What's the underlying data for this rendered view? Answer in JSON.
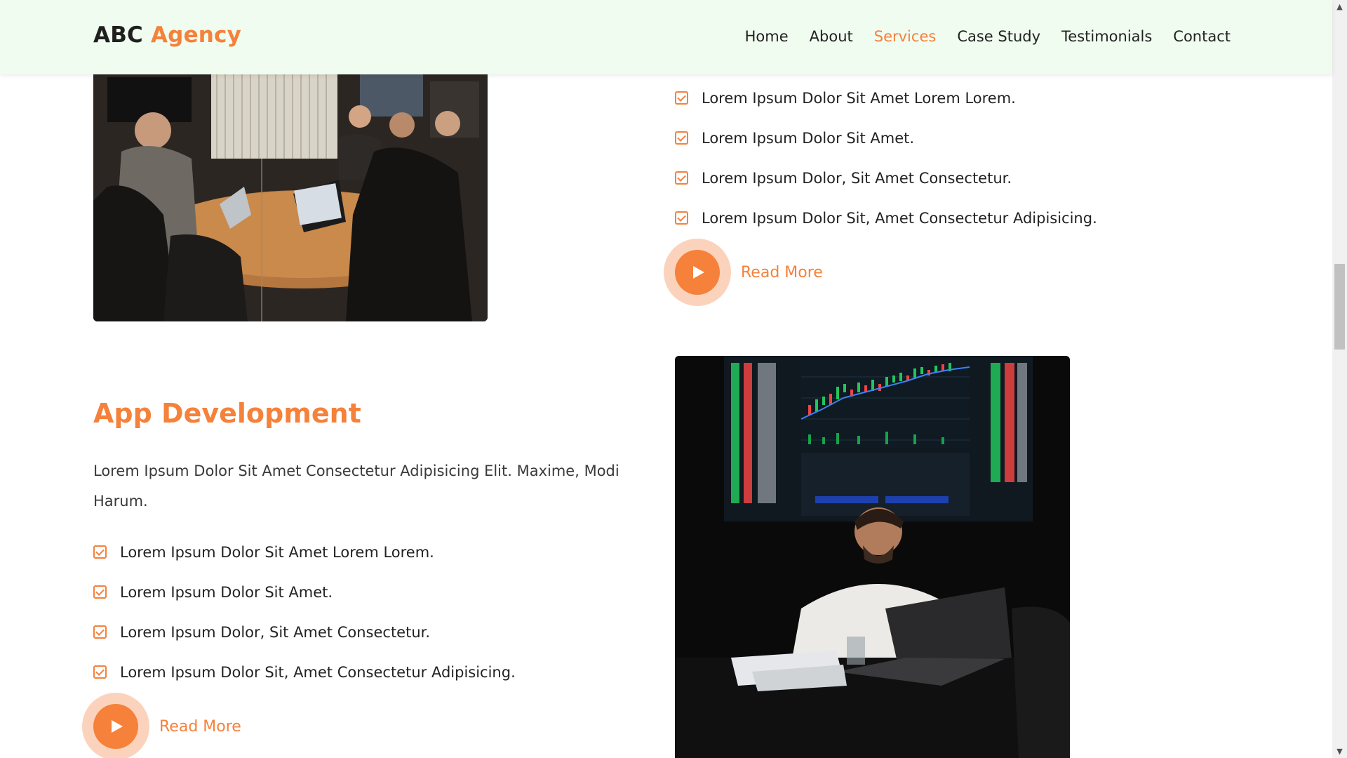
{
  "header": {
    "logo_primary": "ABC",
    "logo_accent": "Agency",
    "nav": [
      "Home",
      "About",
      "Services",
      "Case Study",
      "Testimonials",
      "Contact"
    ],
    "active_nav": "Services",
    "accent_color": "#f5813a",
    "background_color": "#effcef"
  },
  "section_top": {
    "image_description": "team meeting around a conference table",
    "checklist": [
      "Lorem Ipsum Dolor Sit Amet Lorem Lorem.",
      "Lorem Ipsum Dolor Sit Amet.",
      "Lorem Ipsum Dolor, Sit Amet Consectetur.",
      "Lorem Ipsum Dolor Sit, Amet Consectetur Adipisicing."
    ],
    "read_more": "Read More"
  },
  "section_app": {
    "title": "App Development",
    "description": "Lorem Ipsum Dolor Sit Amet Consectetur Adipisicing Elit. Maxime, Modi Harum.",
    "checklist": [
      "Lorem Ipsum Dolor Sit Amet Lorem Lorem.",
      "Lorem Ipsum Dolor Sit Amet.",
      "Lorem Ipsum Dolor, Sit Amet Consectetur.",
      "Lorem Ipsum Dolor Sit, Amet Consectetur Adipisicing."
    ],
    "read_more": "Read More"
  },
  "icons": {
    "checkbox": "checkbox-checked-icon",
    "play": "play-icon",
    "scroll_up": "chevron-up-icon",
    "scroll_down": "chevron-down-icon"
  }
}
